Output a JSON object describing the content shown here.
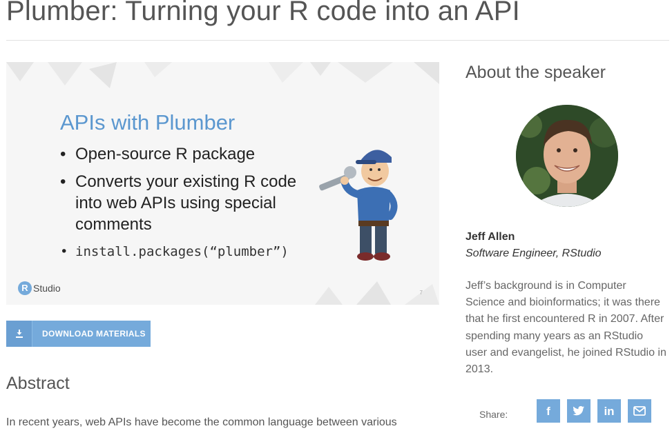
{
  "page": {
    "title": "Plumber: Turning your R code into an API"
  },
  "slide": {
    "heading": "APIs with Plumber",
    "bullets": [
      "Open-source R package",
      "Converts your existing R code into web APIs using special comments",
      "install.packages(“plumber”)"
    ],
    "logo_letter": "R",
    "logo_text": "Studio",
    "page_number": "7"
  },
  "download": {
    "label": "DOWNLOAD MATERIALS",
    "icon": "download-icon"
  },
  "abstract": {
    "heading": "Abstract",
    "text": "In recent years, web APIs have become the common language between various"
  },
  "speaker": {
    "section_heading": "About the speaker",
    "name": "Jeff Allen",
    "role": "Software Engineer, RStudio",
    "bio": "Jeff’s background is in Computer Science and bioinformatics; it was there that he first encountered R in 2007. After spending many years as an RStudio user and evangelist, he joined RStudio in 2013."
  },
  "share": {
    "label": "Share:",
    "buttons": [
      {
        "icon": "facebook-icon",
        "glyph": "f"
      },
      {
        "icon": "twitter-icon",
        "glyph": ""
      },
      {
        "icon": "linkedin-icon",
        "glyph": "in"
      },
      {
        "icon": "email-icon",
        "glyph": ""
      }
    ]
  },
  "colors": {
    "accent": "#75aadb",
    "slide_heading": "#5b97cf",
    "slide_bg": "#f6f6f6"
  }
}
